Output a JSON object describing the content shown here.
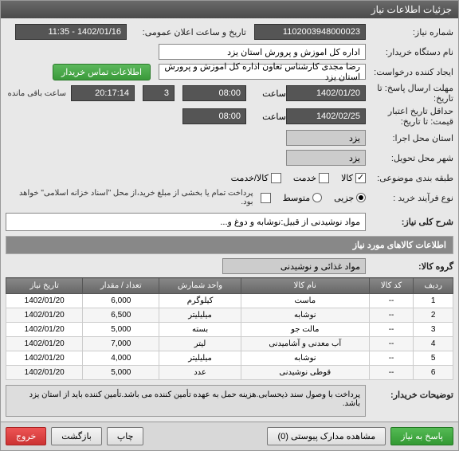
{
  "window": {
    "title": "جزئیات اطلاعات نیاز"
  },
  "header": {
    "need_number_label": "شماره نیاز:",
    "need_number": "1102003948000023",
    "announce_label": "تاریخ و ساعت اعلان عمومی:",
    "announce_value": "1402/01/16 - 11:35",
    "org_label": "نام دستگاه خریدار:",
    "org_value": "اداره کل اموزش و پرورش استان یزد",
    "creator_label": "ایجاد کننده درخواست:",
    "creator_value": "رضا مجدی کارشناس تعاون اداره کل اموزش و پرورش استان یزد",
    "contact_btn": "اطلاعات تماس خریدار",
    "deadline_label": "مهلت ارسال پاسخ: تا تاریخ:",
    "deadline_date": "1402/01/20",
    "deadline_time": "08:00",
    "deadline_days": "3",
    "remaining_value": "20:17:14",
    "remaining_label": "ساعت باقی مانده",
    "validity_label": "حداقل تاریخ اعتبار قیمت: تا تاریخ:",
    "validity_date": "1402/02/25",
    "validity_time": "08:00",
    "time_label": "ساعت",
    "city_exec_label": "استان محل اجرا:",
    "city_exec": "یزد",
    "city_deliver_label": "شهر محل تحویل:",
    "city_deliver": "یزد",
    "category_label": "طبقه بندی موضوعی:",
    "cat_goods": "کالا",
    "cat_service": "خدمت",
    "cat_goods_service": "کالا/خدمت",
    "process_label": "نوع فرآیند خرید :",
    "proc_minor": "جزیی",
    "proc_medium": "متوسط",
    "proc_note": "پرداخت تمام یا بخشی از مبلغ خرید،از محل \"اسناد خزانه اسلامی\" خواهد بود."
  },
  "description": {
    "label": "شرح کلی نیاز:",
    "text": "مواد نوشیدنی از قبیل:نوشابه و دوغ و..."
  },
  "goods_section": {
    "title": "اطلاعات کالاهای مورد نیاز",
    "group_label": "گروه کالا:",
    "group_value": "مواد غذائی و نوشیدنی"
  },
  "table": {
    "headers": [
      "ردیف",
      "کد کالا",
      "نام کالا",
      "واحد شمارش",
      "تعداد / مقدار",
      "تاریخ نیاز"
    ],
    "rows": [
      [
        "1",
        "--",
        "ماست",
        "کیلوگرم",
        "6,000",
        "1402/01/20"
      ],
      [
        "2",
        "--",
        "نوشابه",
        "میلیلیتر",
        "6,500",
        "1402/01/20"
      ],
      [
        "3",
        "--",
        "مالت جو",
        "بسته",
        "5,000",
        "1402/01/20"
      ],
      [
        "4",
        "--",
        "آب معدنی و آشامیدنی",
        "لیتر",
        "7,000",
        "1402/01/20"
      ],
      [
        "5",
        "--",
        "نوشابه",
        "میلیلیتر",
        "4,000",
        "1402/01/20"
      ],
      [
        "6",
        "--",
        "قوطی نوشیدنی",
        "عدد",
        "5,000",
        "1402/01/20"
      ]
    ]
  },
  "buyer_notes": {
    "label": "توضیحات خریدار:",
    "text": "پرداخت با وصول سند ذیحسابی.هزینه حمل به عهده تأمین کننده می باشد.تأمین کننده باید از استان یزد باشد."
  },
  "footer": {
    "respond": "پاسخ به نیاز",
    "attachments": "مشاهده مدارک پیوستی (0)",
    "print": "چاپ",
    "back": "بازگشت",
    "exit": "خروج"
  }
}
